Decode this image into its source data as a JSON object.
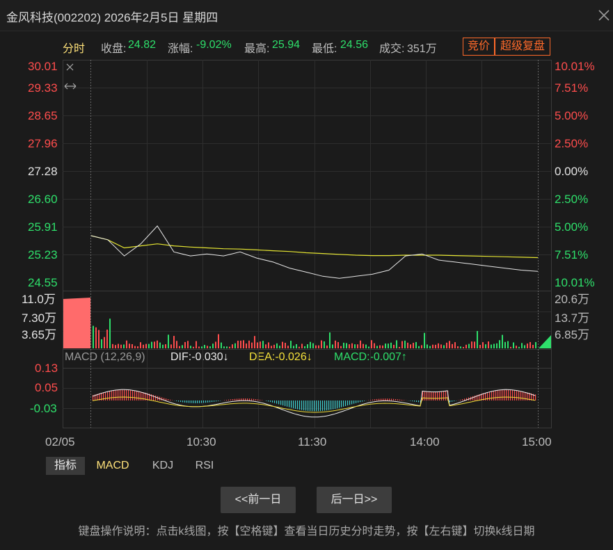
{
  "window": {
    "title": "金风科技(002202) 2026年2月5日 星期四"
  },
  "info": {
    "mode": "分时",
    "close_label": "收盘:",
    "close_value": "24.82",
    "change_label": "涨幅:",
    "change_value": "-9.02%",
    "high_label": "最高:",
    "high_value": "25.94",
    "low_label": "最低:",
    "low_value": "24.56",
    "volume_label": "成交:",
    "volume_value": "351万",
    "btn_auction": "竞价",
    "btn_replay": "超级复盘"
  },
  "price_axis": {
    "left": [
      "30.01",
      "29.33",
      "28.65",
      "27.96",
      "27.28",
      "26.60",
      "25.91",
      "25.23",
      "24.55"
    ],
    "right": [
      "10.01%",
      "7.51%",
      "5.00%",
      "2.50%",
      "0.00%",
      "2.50%",
      "5.00%",
      "7.51%",
      "10.01%"
    ]
  },
  "volume_axis": {
    "left": [
      "11.0万",
      "7.30万",
      "3.65万"
    ],
    "right": [
      "20.6万",
      "13.7万",
      "6.85万"
    ]
  },
  "macd_header": {
    "name": "MACD (12,26,9)",
    "dif": "DIF:-0.030↓",
    "dea": "DEA:-0.026↓",
    "macd": "MACD:-0.007↑"
  },
  "macd_axis": [
    "0.13",
    "0.05",
    "-0.03"
  ],
  "time_axis": [
    "02/05",
    "10:30",
    "11:30",
    "14:00",
    "15:00"
  ],
  "indicator_tabs": {
    "label": "指标",
    "items": [
      "MACD",
      "KDJ",
      "RSI"
    ]
  },
  "nav": {
    "prev": "<<前一日",
    "next": "后一日>>"
  },
  "footer": "键盘操作说明：点击k线图，按【空格键】查看当日历史分时走势，按【左右键】切换k线日期",
  "colors": {
    "up": "#ff4d4d",
    "down": "#2ee06b",
    "avg_line": "#e6e632",
    "price_line": "#e8e8e8",
    "accent_orange": "#ff6a2a",
    "macd_neg": "#3fd0d0"
  },
  "chart_data": {
    "type": "line",
    "prev_close": 27.28,
    "ylim": [
      24.55,
      30.01
    ],
    "x": [
      "09:25",
      "09:30",
      "09:32",
      "09:35",
      "09:40",
      "09:45",
      "09:50",
      "10:00",
      "10:10",
      "10:20",
      "10:30",
      "10:45",
      "11:00",
      "11:15",
      "11:30",
      "13:10",
      "13:20",
      "13:30",
      "13:40",
      "13:45",
      "13:50",
      "14:00",
      "14:10",
      "14:20",
      "14:30",
      "14:40",
      "14:50",
      "15:00"
    ],
    "series": [
      {
        "values": [
          25.7,
          25.6,
          25.2,
          25.5,
          25.94,
          25.3,
          25.2,
          25.25,
          25.2,
          25.3,
          25.15,
          25.05,
          24.9,
          24.8,
          24.7,
          24.65,
          24.7,
          24.75,
          24.85,
          25.2,
          25.25,
          25.1,
          25.05,
          25.0,
          24.95,
          24.9,
          24.85,
          24.82
        ]
      },
      {
        "values": [
          25.7,
          25.6,
          25.4,
          25.45,
          25.5,
          25.45,
          25.42,
          25.4,
          25.38,
          25.37,
          25.35,
          25.33,
          25.31,
          25.28,
          25.26,
          25.24,
          25.22,
          25.21,
          25.21,
          25.22,
          25.22,
          25.22,
          25.21,
          25.2,
          25.19,
          25.18,
          25.17,
          25.16
        ]
      }
    ]
  }
}
